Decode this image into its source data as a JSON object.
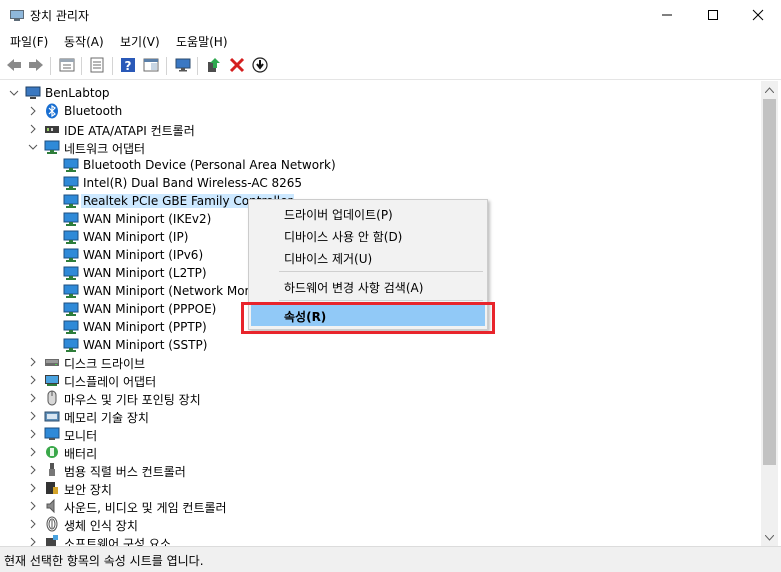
{
  "window": {
    "title": "장치 관리자"
  },
  "menubar": {
    "items": [
      "파일(F)",
      "동작(A)",
      "보기(V)",
      "도움말(H)"
    ]
  },
  "toolbar": {
    "icons": [
      "back-arrow-icon",
      "forward-arrow-icon",
      "properties-sheet-icon",
      "view-list-icon",
      "help-icon",
      "action-pane-icon",
      "monitor-scan-icon",
      "update-driver-icon",
      "uninstall-x-icon",
      "disable-device-icon"
    ]
  },
  "tree": {
    "root": "BenLabtop",
    "categories": {
      "bluetooth": "Bluetooth",
      "ide": "IDE ATA/ATAPI 컨트롤러",
      "network": "네트워크 어댑터",
      "disk": "디스크 드라이브",
      "display": "디스플레이 어댑터",
      "mouse": "마우스 및 기타 포인팅 장치",
      "memory": "메모리 기술 장치",
      "monitor": "모니터",
      "battery": "배터리",
      "usb": "범용 직렬 버스 컨트롤러",
      "security": "보안 장치",
      "audio": "사운드, 비디오 및 게임 컨트롤러",
      "biometric": "생체 인식 장치",
      "software": "소프트웨어 구성 요소"
    },
    "network_children": [
      "Bluetooth Device (Personal Area Network)",
      "Intel(R) Dual Band Wireless-AC 8265",
      "Realtek PCIe GBE Family Controller",
      "WAN Miniport (IKEv2)",
      "WAN Miniport (IP)",
      "WAN Miniport (IPv6)",
      "WAN Miniport (L2TP)",
      "WAN Miniport (Network Monitor)",
      "WAN Miniport (PPPOE)",
      "WAN Miniport (PPTP)",
      "WAN Miniport (SSTP)"
    ]
  },
  "context_menu": {
    "update_driver": "드라이버 업데이트(P)",
    "disable": "디바이스 사용 안 함(D)",
    "uninstall": "디바이스 제거(U)",
    "scan": "하드웨어 변경 사항 검색(A)",
    "properties": "속성(R)"
  },
  "status": {
    "text": "현재 선택한 항목의 속성 시트를 엽니다."
  },
  "colors": {
    "selection": "#cce8ff",
    "menu_highlight": "#91c9f7",
    "annotation_red": "#e8242b"
  }
}
